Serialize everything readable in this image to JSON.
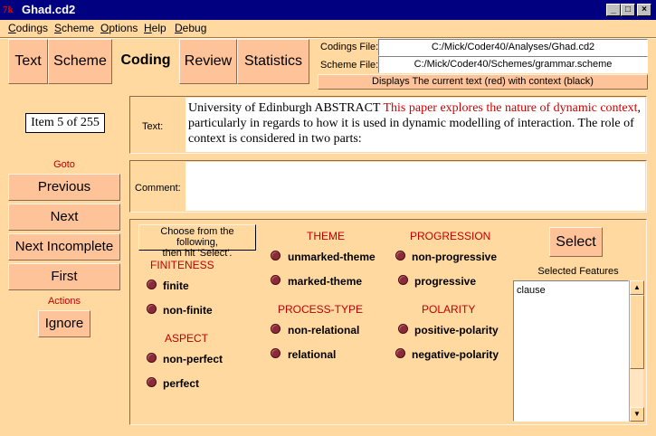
{
  "window": {
    "title": "Ghad.cd2",
    "tk_logo": "7k",
    "min_glyph": "_",
    "max_glyph": "□",
    "close_glyph": "×"
  },
  "menu": [
    {
      "u": "C",
      "rest": "odings"
    },
    {
      "u": "S",
      "rest": "cheme"
    },
    {
      "u": "O",
      "rest": "ptions"
    },
    {
      "u": "H",
      "rest": "elp"
    },
    {
      "u": "D",
      "rest": "ebug"
    }
  ],
  "tabs": [
    "Text",
    "Scheme",
    "Coding",
    "Review",
    "Statistics"
  ],
  "files": {
    "codings_label": "Codings File:",
    "codings_value": "C:/Mick/Coder40/Analyses/Ghad.cd2",
    "scheme_label": "Scheme File:",
    "scheme_value": "C:/Mick/Coder40/Schemes/grammar.scheme",
    "display_button": "Displays The current text (red) with context (black)"
  },
  "left": {
    "item_counter": "Item 5 of 255",
    "goto_label": "Goto",
    "previous": "Previous",
    "next": "Next",
    "next_incomplete": "Next Incomplete",
    "first": "First",
    "actions_label": "Actions",
    "ignore": "Ignore"
  },
  "text_panel": {
    "label": "Text:",
    "context_before": "University of Edinburgh ABSTRACT ",
    "current": "This paper explores the nature of dynamic context",
    "context_after": ", particularly in regards to how it is used in dynamic modelling of interaction. The role of context is considered in two parts:"
  },
  "comment_panel": {
    "label": "Comment:"
  },
  "features": {
    "instruction_line1": "Choose from the following,",
    "instruction_line2": "then hit 'Select'.",
    "select_button": "Select",
    "selected_label": "Selected Features",
    "selected_items": [
      "clause"
    ],
    "up_arrow": "▲",
    "down_arrow": "▼",
    "systems": {
      "finiteness": {
        "name": "FINITENESS",
        "options": [
          "finite",
          "non-finite"
        ]
      },
      "aspect": {
        "name": "ASPECT",
        "options": [
          "non-perfect",
          "perfect"
        ]
      },
      "theme": {
        "name": "THEME",
        "options": [
          "unmarked-theme",
          "marked-theme"
        ]
      },
      "process_type": {
        "name": "PROCESS-TYPE",
        "options": [
          "non-relational",
          "relational"
        ]
      },
      "progression": {
        "name": "PROGRESSION",
        "options": [
          "non-progressive",
          "progressive"
        ]
      },
      "polarity": {
        "name": "POLARITY",
        "options": [
          "positive-polarity",
          "negative-polarity"
        ]
      }
    }
  }
}
